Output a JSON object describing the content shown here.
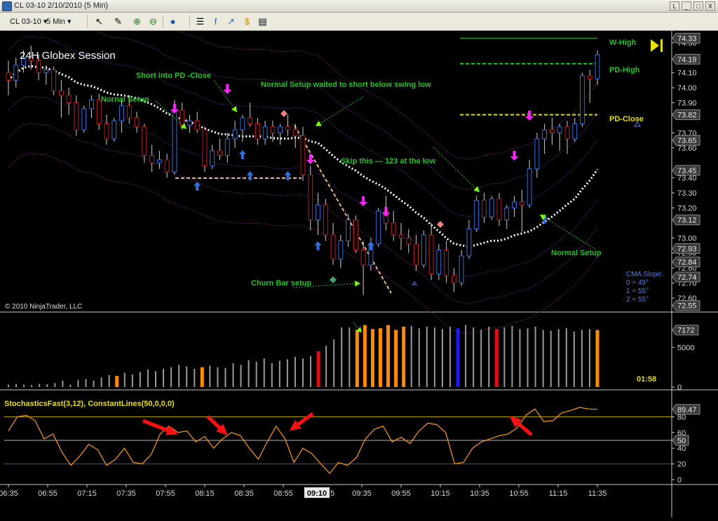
{
  "window": {
    "title": "CL 03-10  2/10/2010 (5 Min)",
    "buttons": [
      "L",
      "_",
      "□",
      "X"
    ]
  },
  "toolbar": {
    "instrument": "CL 03-10",
    "interval": "5 Min",
    "icons": [
      "pencil-icon",
      "zoom-in-icon",
      "zoom-out-icon",
      "globe-icon",
      "properties-icon",
      "indicators-icon",
      "strategy-icon",
      "dollar-icon",
      "data-box-icon"
    ]
  },
  "chart_data": [
    {
      "type": "candlestick",
      "title": "24H Globex Session",
      "copyright": "© 2010 NinjaTrader, LLC",
      "y_ticks": [
        "74.30",
        "74.10",
        "74.00",
        "73.90",
        "73.70",
        "73.60",
        "73.40",
        "73.30",
        "73.20",
        "73.00",
        "72.90",
        "72.80",
        "72.70",
        "72.60"
      ],
      "ylim": [
        72.53,
        74.36
      ],
      "price_flags": [
        "74.33",
        "74.19",
        "73.82",
        "73.65",
        "73.45",
        "73.12",
        "72.93",
        "72.84",
        "72.74",
        "72.55"
      ],
      "levels": [
        {
          "label": "W-High",
          "value": 74.33,
          "color": "#22c322",
          "style": "solid"
        },
        {
          "label": "PD-High",
          "value": 74.16,
          "color": "#22c322",
          "style": "dashed"
        },
        {
          "label": "PD-Close",
          "value": 73.82,
          "color": "#e8e000",
          "style": "dashed"
        }
      ],
      "annotations": [
        "Short into PD -Close",
        "Nornal Setup",
        "Normal Setup waited to short below swing low",
        "Skip this --- 123 at the low",
        "Normal Setup",
        "Churn Bar setup"
      ],
      "cma_slope": {
        "title": "CMA Slope:",
        "lines": [
          "0 = 49°",
          "1 = 55°",
          "2 = 55°"
        ]
      },
      "candles": [
        [
          74.1,
          74.18,
          73.95,
          74.05
        ],
        [
          74.05,
          74.2,
          74.0,
          74.15
        ],
        [
          74.15,
          74.25,
          74.1,
          74.2
        ],
        [
          74.2,
          74.28,
          74.12,
          74.18
        ],
        [
          74.18,
          74.22,
          74.05,
          74.1
        ],
        [
          74.1,
          74.15,
          74.02,
          74.12
        ],
        [
          74.12,
          74.14,
          73.95,
          73.98
        ],
        [
          73.98,
          74.05,
          73.8,
          73.95
        ],
        [
          73.95,
          74.0,
          73.82,
          73.9
        ],
        [
          73.9,
          73.95,
          73.68,
          73.72
        ],
        [
          73.72,
          73.88,
          73.7,
          73.86
        ],
        [
          73.86,
          73.95,
          73.8,
          73.92
        ],
        [
          73.92,
          73.96,
          73.72,
          73.76
        ],
        [
          73.76,
          73.82,
          73.62,
          73.66
        ],
        [
          73.66,
          73.8,
          73.64,
          73.78
        ],
        [
          73.78,
          73.92,
          73.7,
          73.88
        ],
        [
          73.88,
          73.95,
          73.76,
          73.8
        ],
        [
          73.8,
          73.84,
          73.7,
          73.74
        ],
        [
          73.74,
          73.76,
          73.5,
          73.55
        ],
        [
          73.55,
          73.62,
          73.44,
          73.5
        ],
        [
          73.5,
          73.58,
          73.46,
          73.52
        ],
        [
          73.52,
          73.56,
          73.4,
          73.44
        ],
        [
          73.44,
          73.92,
          73.42,
          73.85
        ],
        [
          73.85,
          73.9,
          73.72,
          73.75
        ],
        [
          73.75,
          73.82,
          73.7,
          73.78
        ],
        [
          73.78,
          73.84,
          73.7,
          73.72
        ],
        [
          73.72,
          73.74,
          73.44,
          73.48
        ],
        [
          73.48,
          73.62,
          73.46,
          73.58
        ],
        [
          73.58,
          73.66,
          73.52,
          73.55
        ],
        [
          73.55,
          73.7,
          73.5,
          73.66
        ],
        [
          73.66,
          73.78,
          73.6,
          73.72
        ],
        [
          73.72,
          73.82,
          73.64,
          73.8
        ],
        [
          73.8,
          73.9,
          73.74,
          73.76
        ],
        [
          73.76,
          73.8,
          73.62,
          73.66
        ],
        [
          73.66,
          73.78,
          73.62,
          73.74
        ],
        [
          73.74,
          73.78,
          73.64,
          73.7
        ],
        [
          73.7,
          73.76,
          73.62,
          73.74
        ],
        [
          73.74,
          73.82,
          73.68,
          73.72
        ],
        [
          73.72,
          73.76,
          73.6,
          73.68
        ],
        [
          73.68,
          73.74,
          73.38,
          73.42
        ],
        [
          73.42,
          73.48,
          73.05,
          73.12
        ],
        [
          73.12,
          73.3,
          73.02,
          73.22
        ],
        [
          73.22,
          73.26,
          72.98,
          73.02
        ],
        [
          73.02,
          73.1,
          72.82,
          72.86
        ],
        [
          72.86,
          73.02,
          72.8,
          72.98
        ],
        [
          72.98,
          73.16,
          72.94,
          73.12
        ],
        [
          73.12,
          73.15,
          72.9,
          72.92
        ],
        [
          72.92,
          72.98,
          72.62,
          72.82
        ],
        [
          72.82,
          73.0,
          72.78,
          72.96
        ],
        [
          72.96,
          73.2,
          72.94,
          73.18
        ],
        [
          73.18,
          73.28,
          73.05,
          73.1
        ],
        [
          73.1,
          73.18,
          72.98,
          73.02
        ],
        [
          73.02,
          73.1,
          72.92,
          73.0
        ],
        [
          73.0,
          73.06,
          72.9,
          72.96
        ],
        [
          72.96,
          73.02,
          72.78,
          72.82
        ],
        [
          72.82,
          73.05,
          72.8,
          73.02
        ],
        [
          73.02,
          73.1,
          72.72,
          72.76
        ],
        [
          72.76,
          72.96,
          72.72,
          72.92
        ],
        [
          72.92,
          72.98,
          72.7,
          72.75
        ],
        [
          72.75,
          72.8,
          72.64,
          72.7
        ],
        [
          72.7,
          72.92,
          72.68,
          72.88
        ],
        [
          72.88,
          73.12,
          72.86,
          73.06
        ],
        [
          73.06,
          73.28,
          73.04,
          73.25
        ],
        [
          73.25,
          73.3,
          73.1,
          73.14
        ],
        [
          73.14,
          73.28,
          73.12,
          73.26
        ],
        [
          73.26,
          73.3,
          73.08,
          73.12
        ],
        [
          73.12,
          73.22,
          73.06,
          73.2
        ],
        [
          73.2,
          73.28,
          73.14,
          73.24
        ],
        [
          73.24,
          73.32,
          73.04,
          73.22
        ],
        [
          73.22,
          73.52,
          73.2,
          73.46
        ],
        [
          73.46,
          73.7,
          73.4,
          73.66
        ],
        [
          73.66,
          73.76,
          73.56,
          73.72
        ],
        [
          73.72,
          73.8,
          73.62,
          73.7
        ],
        [
          73.7,
          73.76,
          73.58,
          73.74
        ],
        [
          73.74,
          73.78,
          73.56,
          73.66
        ],
        [
          73.66,
          73.8,
          73.64,
          73.76
        ],
        [
          73.76,
          74.1,
          73.74,
          74.08
        ],
        [
          74.08,
          74.12,
          73.9,
          74.06
        ],
        [
          74.06,
          74.25,
          74.02,
          74.22
        ]
      ]
    },
    {
      "type": "bar",
      "title": "Volume",
      "y_ticks": [
        "5000",
        "0"
      ],
      "last_value_flag": "7172",
      "timer": "01:58",
      "values": [
        300,
        400,
        300,
        250,
        400,
        350,
        500,
        800,
        300,
        900,
        1000,
        800,
        1200,
        1500,
        1400,
        1800,
        1600,
        1900,
        2200,
        2000,
        2300,
        2500,
        2800,
        2600,
        2300,
        2500,
        2700,
        2500,
        2400,
        3000,
        2800,
        3400,
        3200,
        3600,
        3000,
        3300,
        3500,
        3800,
        3600,
        3900,
        4500,
        5200,
        6000,
        7500,
        7500,
        7200,
        7800,
        7300,
        7400,
        7800,
        7200,
        7600,
        7700,
        7400,
        7600,
        7500,
        7300,
        7600,
        7400,
        7800,
        7500,
        7200,
        7600,
        7300,
        7500,
        7700,
        7300,
        7400,
        7600,
        7200,
        7100,
        7300,
        7400,
        7000,
        7200,
        7300,
        7172
      ],
      "ylim": [
        0,
        9000
      ],
      "colors": {
        "normal": "#9a9a9a",
        "orange": "#ff8c00",
        "red": "#e01010",
        "blue": "#1a1aff"
      }
    },
    {
      "type": "line",
      "title": "StochasticsFast(3,12), ConstantLines(50,0,0,0)",
      "y_ticks": [
        "80",
        "60",
        "40",
        "20",
        "0"
      ],
      "last_value_flag": "89.47",
      "mid_flag": "50",
      "ylim": [
        0,
        100
      ],
      "h_lines": [
        80,
        50,
        20
      ],
      "values": [
        62,
        80,
        82,
        75,
        52,
        58,
        35,
        18,
        30,
        45,
        38,
        18,
        26,
        40,
        22,
        20,
        32,
        58,
        68,
        60,
        62,
        48,
        55,
        40,
        52,
        60,
        56,
        40,
        26,
        48,
        68,
        52,
        22,
        40,
        33,
        20,
        8,
        22,
        18,
        28,
        52,
        64,
        68,
        48,
        54,
        46,
        62,
        72,
        70,
        60,
        20,
        22,
        40,
        48,
        52,
        56,
        58,
        66,
        82,
        90,
        74,
        75,
        85,
        88,
        92,
        90,
        89.47
      ]
    }
  ],
  "time_axis": {
    "labels": [
      "06:35",
      "06:55",
      "07:15",
      "07:35",
      "07:55",
      "08:15",
      "08:35",
      "08:55",
      "09:35",
      "09:55",
      "10:15",
      "10:35",
      "10:55",
      "11:15",
      "11:35"
    ],
    "cursor_label": "09:10",
    "partial_label": "5"
  }
}
